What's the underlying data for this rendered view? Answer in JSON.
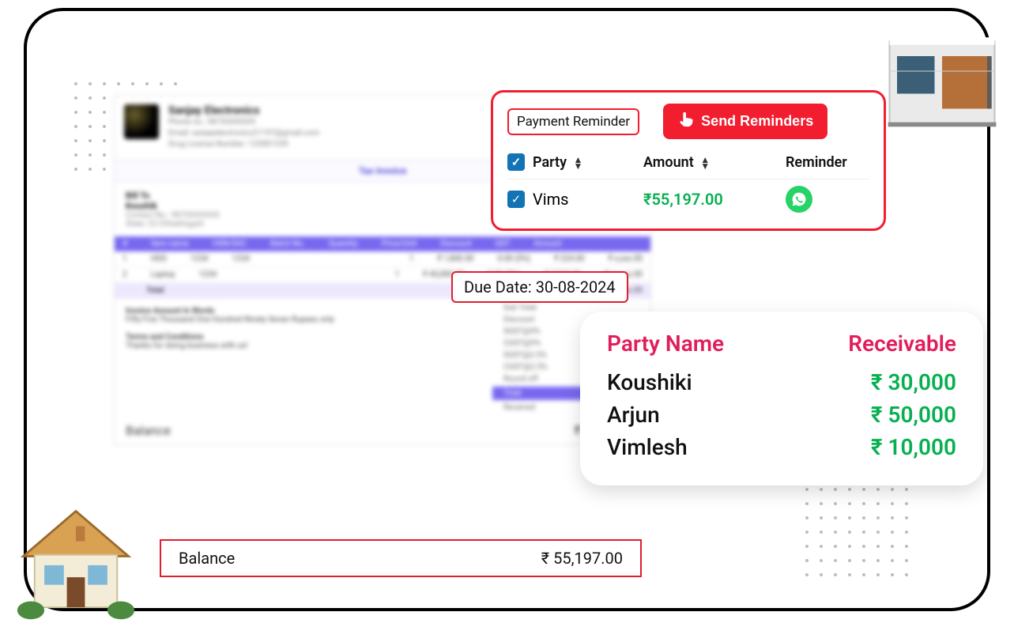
{
  "invoice": {
    "company": "Sanjay Electronics",
    "title": "Tax Invoice",
    "bill_to_label": "Bill To",
    "bill_to_name": "Koushik",
    "items": [
      {
        "name": "HDD",
        "qty": "1"
      },
      {
        "name": "Laptop",
        "qty": "1"
      }
    ],
    "total_label": "Total",
    "words_label": "Invoice Amount In Words",
    "words_value": "Fifty Five Thousand One Hundred Ninety Seven Rupees only",
    "terms_label": "Terms and Conditions",
    "terms_value": "Thanks for doing business with us!",
    "sub_total": "Sub Total",
    "round_off": "Round off",
    "grand_total": "Total",
    "received": "Received",
    "balance_label": "Balance"
  },
  "due_date": {
    "label": "Due Date:",
    "value": "30-08-2024"
  },
  "balance": {
    "label": "Balance",
    "value": "₹ 55,197.00"
  },
  "reminder": {
    "toggle_label": "Payment Reminder",
    "send_label": "Send Reminders",
    "col_party": "Party",
    "col_amount": "Amount",
    "col_reminder": "Reminder",
    "rows": [
      {
        "party": "Vims",
        "amount": "₹55,197.00"
      }
    ]
  },
  "receivable": {
    "col_party": "Party Name",
    "col_amount": "Receivable",
    "rows": [
      {
        "name": "Koushiki",
        "amount": "₹ 30,000"
      },
      {
        "name": "Arjun",
        "amount": "₹ 50,000"
      },
      {
        "name": "Vimlesh",
        "amount": "₹ 10,000"
      }
    ]
  }
}
